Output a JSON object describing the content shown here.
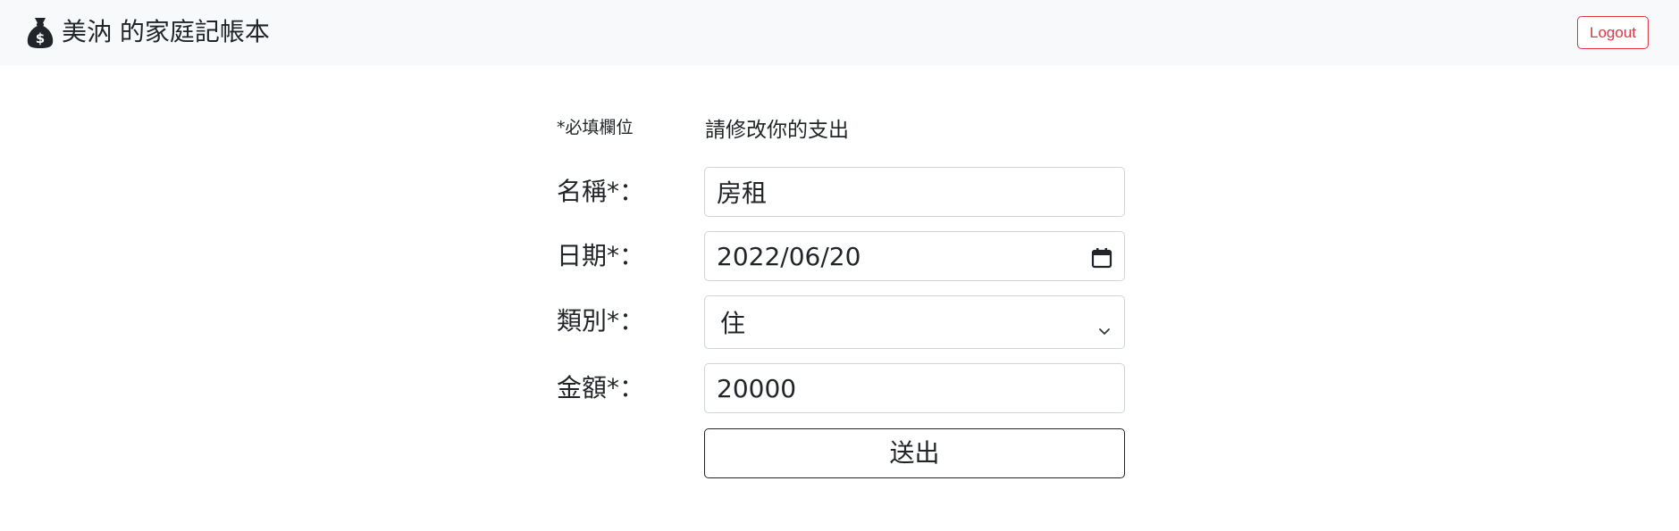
{
  "navbar": {
    "brand_icon": "money-bag-icon",
    "brand_title": "美汭 的家庭記帳本",
    "logout_label": "Logout",
    "logout_color": "#dc3545",
    "background": "#f8f9fa"
  },
  "form": {
    "required_note": "*必填欄位",
    "heading": "請修改你的支出",
    "fields": {
      "name": {
        "label": "名稱*：",
        "value": "房租"
      },
      "date": {
        "label": "日期*：",
        "value": "2022/06/20",
        "icon": "calendar-icon"
      },
      "category": {
        "label": "類別*：",
        "selected": "住",
        "icon": "chevron-down-icon"
      },
      "amount": {
        "label": "金額*：",
        "value": "20000"
      }
    },
    "submit_label": "送出"
  }
}
